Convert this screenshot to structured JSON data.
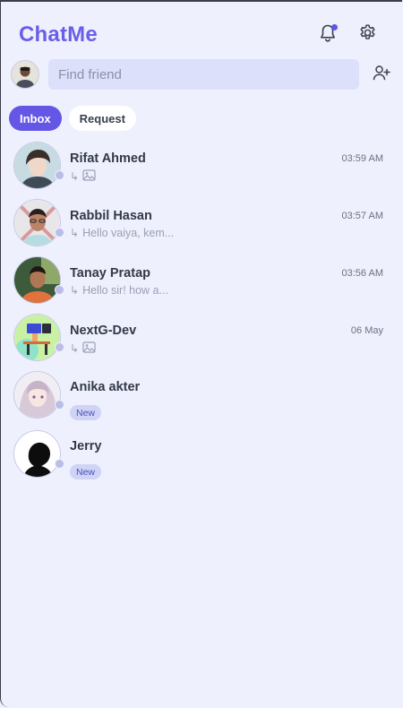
{
  "app": {
    "brand": "ChatMe",
    "accent": "#6557e5"
  },
  "header": {
    "notifications_icon": "bell-icon",
    "settings_icon": "gear-icon"
  },
  "search": {
    "placeholder": "Find friend",
    "value": ""
  },
  "tabs": [
    {
      "label": "Inbox",
      "active": true
    },
    {
      "label": "Request",
      "active": false
    }
  ],
  "conversations": [
    {
      "name": "Rifat Ahmed",
      "time": "03:59 AM",
      "preview": "",
      "preview_icon": "image-icon"
    },
    {
      "name": "Rabbil Hasan",
      "time": "03:57 AM",
      "preview": "Hello vaiya, kem...",
      "preview_icon": ""
    },
    {
      "name": "Tanay Pratap",
      "time": "03:56 AM",
      "preview": "Hello sir! how a...",
      "preview_icon": ""
    },
    {
      "name": "NextG-Dev",
      "time": "06 May",
      "preview": "",
      "preview_icon": "image-icon"
    },
    {
      "name": "Anika akter",
      "time": "",
      "badge": "New"
    },
    {
      "name": "Jerry",
      "time": "",
      "badge": "New"
    }
  ]
}
